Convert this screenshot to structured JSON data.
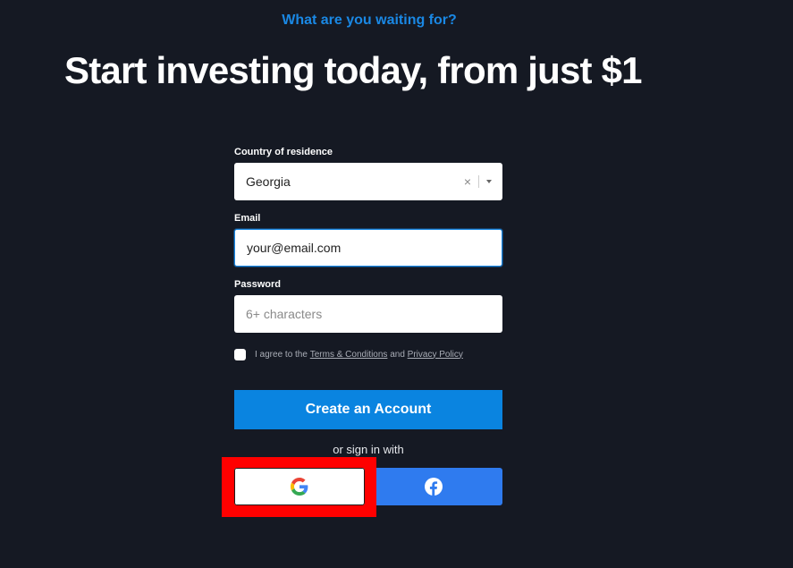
{
  "header": {
    "eyebrow": "What are you waiting for?",
    "headline": "Start investing today, from just $1"
  },
  "form": {
    "country": {
      "label": "Country of residence",
      "value": "Georgia",
      "clear_icon": "close-icon",
      "dropdown_icon": "caret-down-icon"
    },
    "email": {
      "label": "Email",
      "value": "your@email.com",
      "placeholder": "your@email.com"
    },
    "password": {
      "label": "Password",
      "placeholder": "6+ characters"
    },
    "agree": {
      "prefix": "I agree to the",
      "terms_link": "Terms & Conditions",
      "middle": "and",
      "privacy_link": "Privacy Policy",
      "checked": false
    },
    "submit_label": "Create an Account",
    "social_label": "or sign in with"
  },
  "social": {
    "google_icon": "google-icon",
    "facebook_icon": "facebook-icon"
  },
  "colors": {
    "background": "#151923",
    "accent": "#1a88e4",
    "primary_button": "#0a84e0",
    "facebook": "#2f7bef",
    "highlight": "#ff0000"
  }
}
